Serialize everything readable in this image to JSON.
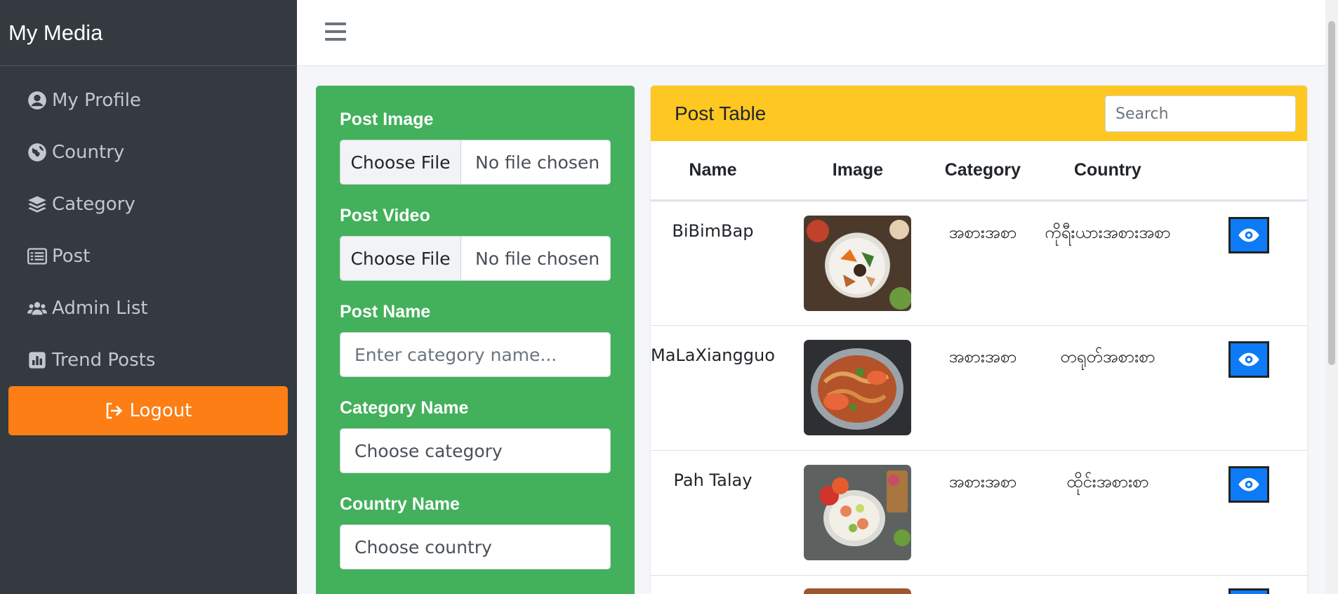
{
  "sidebar": {
    "brand": "My Media",
    "items": [
      {
        "label": "My Profile",
        "icon": "user-circle-icon"
      },
      {
        "label": "Country",
        "icon": "globe-icon"
      },
      {
        "label": "Category",
        "icon": "layers-icon"
      },
      {
        "label": "Post",
        "icon": "list-icon"
      },
      {
        "label": "Admin List",
        "icon": "users-icon"
      },
      {
        "label": "Trend Posts",
        "icon": "chart-icon"
      }
    ],
    "logout_label": "Logout"
  },
  "form": {
    "post_image_label": "Post Image",
    "post_video_label": "Post Video",
    "choose_file_label": "Choose File",
    "no_file_label": "No file chosen",
    "post_name_label": "Post Name",
    "post_name_placeholder": "Enter category name...",
    "category_label": "Category Name",
    "category_value": "Choose category",
    "country_label": "Country Name",
    "country_value": "Choose country"
  },
  "table": {
    "title": "Post Table",
    "search_placeholder": "Search",
    "columns": [
      "Name",
      "Image",
      "Category",
      "Country"
    ],
    "rows": [
      {
        "name": "BiBimBap",
        "category": "အစားအစာ",
        "country": "ကိုရီးယားအစားအစာ"
      },
      {
        "name": "MaLaXiangguo",
        "category": "အစားအစာ",
        "country": "တရုတ်အစားစာ"
      },
      {
        "name": "Pah Talay",
        "category": "အစားအစာ",
        "country": "ထိုင်းအစားစာ"
      }
    ]
  },
  "colors": {
    "sidebar_bg": "#343a40",
    "logout_bg": "#fd7e14",
    "form_bg": "#43b05c",
    "header_bg": "#ffc721",
    "view_button": "#0d7bf5"
  }
}
